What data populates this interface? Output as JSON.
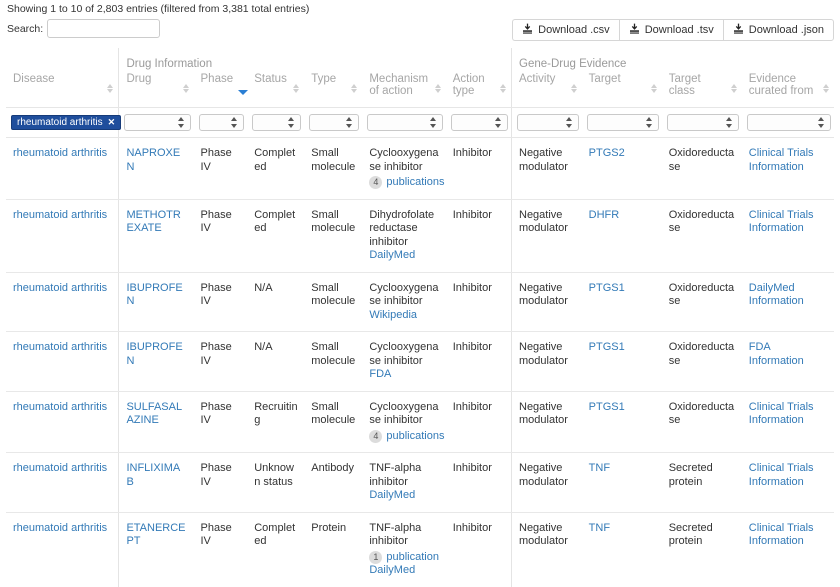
{
  "header": {
    "info_text": "Showing 1 to 10 of 2,803 entries (filtered from 3,381 total entries)",
    "search_label": "Search:",
    "search_value": "",
    "search_placeholder": ""
  },
  "downloads": [
    {
      "label": "Download .csv",
      "icon": "download-icon"
    },
    {
      "label": "Download .tsv",
      "icon": "download-icon"
    },
    {
      "label": "Download .json",
      "icon": "download-icon"
    }
  ],
  "groups": [
    {
      "label": "",
      "span": 1,
      "border": false
    },
    {
      "label": "Drug Information",
      "span": 5,
      "border": true
    },
    {
      "label": "",
      "span": 1,
      "border": false
    },
    {
      "label": "Gene-Drug Evidence",
      "span": 4,
      "border": true
    }
  ],
  "columns": [
    {
      "label": "Disease",
      "sort": "none",
      "border": false
    },
    {
      "label": "Drug",
      "sort": "none",
      "border": true
    },
    {
      "label": "Phase",
      "sort": "desc",
      "border": false
    },
    {
      "label": "Status",
      "sort": "none",
      "border": false
    },
    {
      "label": "Type",
      "sort": "none",
      "border": false
    },
    {
      "label": "Mechanism of action",
      "sort": "none",
      "border": false
    },
    {
      "label": "Action type",
      "sort": "none",
      "border": false
    },
    {
      "label": "Activity",
      "sort": "none",
      "border": true
    },
    {
      "label": "Target",
      "sort": "none",
      "border": false
    },
    {
      "label": "Target class",
      "sort": "none",
      "border": false
    },
    {
      "label": "Evidence curated from",
      "sort": "none",
      "border": false
    }
  ],
  "filters": {
    "disease_tag": "rheumatoid arthritis",
    "remove_icon": "close-icon"
  },
  "rows": [
    {
      "disease": "rheumatoid arthritis",
      "drug": "NAPROXEN",
      "phase": "Phase IV",
      "status": "Completed",
      "type": "Small molecule",
      "moa": "Cyclooxygenase inhibitor",
      "moa_pub_count": "4",
      "moa_pub_label": "publications",
      "moa_sub": "",
      "action_type": "Inhibitor",
      "activity": "Negative modulator",
      "target": "PTGS2",
      "target_class": "Oxidoreductase",
      "evidence": "Clinical Trials Information"
    },
    {
      "disease": "rheumatoid arthritis",
      "drug": "METHOTREXATE",
      "phase": "Phase IV",
      "status": "Completed",
      "type": "Small molecule",
      "moa": "Dihydrofolate reductase inhibitor",
      "moa_pub_count": "",
      "moa_pub_label": "",
      "moa_sub": "DailyMed",
      "action_type": "Inhibitor",
      "activity": "Negative modulator",
      "target": "DHFR",
      "target_class": "Oxidoreductase",
      "evidence": "Clinical Trials Information"
    },
    {
      "disease": "rheumatoid arthritis",
      "drug": "IBUPROFEN",
      "phase": "Phase IV",
      "status": "N/A",
      "type": "Small molecule",
      "moa": "Cyclooxygenase inhibitor",
      "moa_pub_count": "",
      "moa_pub_label": "",
      "moa_sub": "Wikipedia",
      "action_type": "Inhibitor",
      "activity": "Negative modulator",
      "target": "PTGS1",
      "target_class": "Oxidoreductase",
      "evidence": "DailyMed Information"
    },
    {
      "disease": "rheumatoid arthritis",
      "drug": "IBUPROFEN",
      "phase": "Phase IV",
      "status": "N/A",
      "type": "Small molecule",
      "moa": "Cyclooxygenase inhibitor",
      "moa_pub_count": "",
      "moa_pub_label": "",
      "moa_sub": "FDA",
      "action_type": "Inhibitor",
      "activity": "Negative modulator",
      "target": "PTGS1",
      "target_class": "Oxidoreductase",
      "evidence": "FDA Information"
    },
    {
      "disease": "rheumatoid arthritis",
      "drug": "SULFASALAZINE",
      "phase": "Phase IV",
      "status": "Recruiting",
      "type": "Small molecule",
      "moa": "Cyclooxygenase inhibitor",
      "moa_pub_count": "4",
      "moa_pub_label": "publications",
      "moa_sub": "",
      "action_type": "Inhibitor",
      "activity": "Negative modulator",
      "target": "PTGS1",
      "target_class": "Oxidoreductase",
      "evidence": "Clinical Trials Information"
    },
    {
      "disease": "rheumatoid arthritis",
      "drug": "INFLIXIMAB",
      "phase": "Phase IV",
      "status": "Unknown status",
      "type": "Antibody",
      "moa": "TNF-alpha inhibitor",
      "moa_pub_count": "",
      "moa_pub_label": "",
      "moa_sub": "DailyMed",
      "action_type": "Inhibitor",
      "activity": "Negative modulator",
      "target": "TNF",
      "target_class": "Secreted protein",
      "evidence": "Clinical Trials Information"
    },
    {
      "disease": "rheumatoid arthritis",
      "drug": "ETANERCEPT",
      "phase": "Phase IV",
      "status": "Completed",
      "type": "Protein",
      "moa": "TNF-alpha inhibitor",
      "moa_pub_count": "1",
      "moa_pub_label": "publication",
      "moa_sub": "DailyMed",
      "action_type": "Inhibitor",
      "activity": "Negative modulator",
      "target": "TNF",
      "target_class": "Secreted protein",
      "evidence": "Clinical Trials Information"
    }
  ],
  "colors": {
    "link": "#337ab7",
    "tag_bg": "#1f4e9c",
    "sort_active": "#2a7fd4",
    "header_text": "#a6a6a6"
  }
}
